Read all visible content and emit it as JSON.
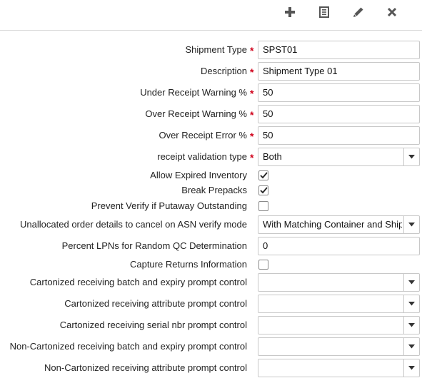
{
  "toolbar": {
    "icons": [
      "plus-icon",
      "document-icon",
      "pencil-icon",
      "close-icon"
    ]
  },
  "fields": {
    "shipment_type": {
      "label": "Shipment Type",
      "value": "SPST01",
      "required": "*"
    },
    "description": {
      "label": "Description",
      "value": "Shipment Type 01",
      "required": "*"
    },
    "under_receipt_warning": {
      "label": "Under Receipt Warning %",
      "value": "50",
      "required": "*"
    },
    "over_receipt_warning": {
      "label": "Over Receipt Warning %",
      "value": "50",
      "required": "*"
    },
    "over_receipt_error": {
      "label": "Over Receipt Error %",
      "value": "50",
      "required": "*"
    },
    "receipt_validation_type": {
      "label": "receipt validation type",
      "value": "Both",
      "required": "*"
    },
    "allow_expired_inventory": {
      "label": "Allow Expired Inventory",
      "checked": true
    },
    "break_prepacks": {
      "label": "Break Prepacks",
      "checked": true
    },
    "prevent_verify": {
      "label": "Prevent Verify if Putaway Outstanding",
      "checked": false
    },
    "unallocated_cancel_mode": {
      "label": "Unallocated order details to cancel on ASN verify mode",
      "value": "With Matching Container and Shipment"
    },
    "percent_lpns_qc": {
      "label": "Percent LPNs for Random QC Determination",
      "value": "0"
    },
    "capture_returns": {
      "label": "Capture Returns Information",
      "checked": false
    },
    "cart_batch_expiry": {
      "label": "Cartonized receiving batch and expiry prompt control",
      "value": ""
    },
    "cart_attribute": {
      "label": "Cartonized receiving attribute prompt control",
      "value": ""
    },
    "cart_serial": {
      "label": "Cartonized receiving serial nbr prompt control",
      "value": ""
    },
    "noncart_batch_expiry": {
      "label": "Non-Cartonized receiving batch and expiry prompt control",
      "value": ""
    },
    "noncart_attribute": {
      "label": "Non-Cartonized receiving attribute prompt control",
      "value": ""
    }
  },
  "colors": {
    "required": "#d0021b",
    "toolbar_icon": "#555555",
    "border": "#c8c8c8"
  }
}
